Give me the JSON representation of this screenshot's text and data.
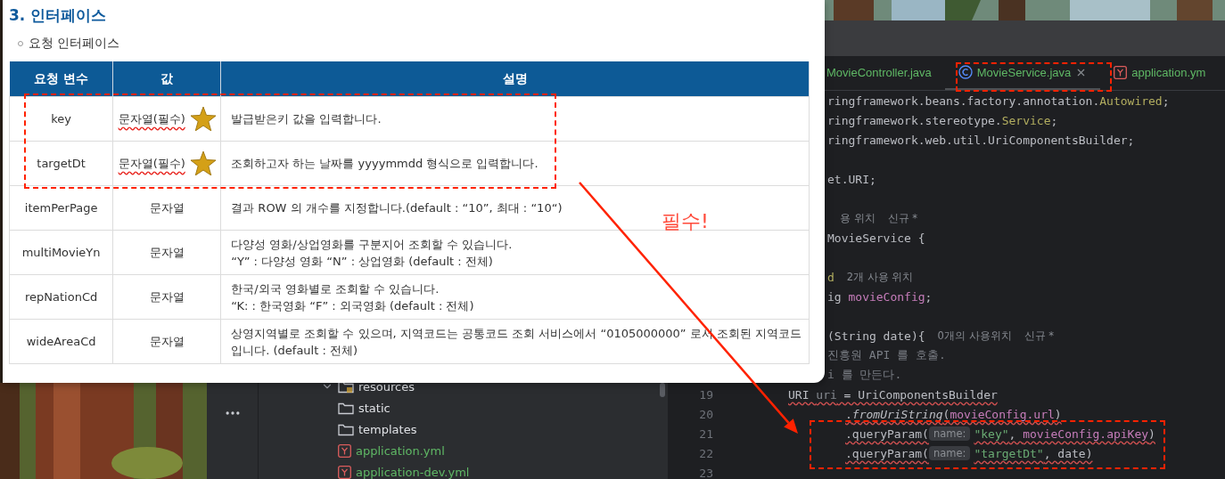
{
  "document": {
    "title": "3. 인터페이스",
    "subtitle": "요청 인터페이스",
    "table": {
      "columns": [
        "요청 변수",
        "값",
        "설명"
      ],
      "rows": [
        {
          "name": "key",
          "value": "문자열(필수)",
          "starred": true,
          "description": [
            "발급받은키 값을 입력합니다."
          ]
        },
        {
          "name": "targetDt",
          "value": "문자열(필수)",
          "starred": true,
          "description": [
            "조회하고자 하는 날짜를 yyyymmdd 형식으로 입력합니다."
          ]
        },
        {
          "name": "itemPerPage",
          "value": "문자열",
          "starred": false,
          "description": [
            "결과 ROW 의 개수를 지정합니다.(default : “10”, 최대 : “10“)"
          ]
        },
        {
          "name": "multiMovieYn",
          "value": "문자열",
          "starred": false,
          "description": [
            "다양성 영화/상업영화를 구분지어 조회할 수 있습니다.",
            "“Y” : 다양성 영화 “N” : 상업영화 (default : 전체)"
          ]
        },
        {
          "name": "repNationCd",
          "value": "문자열",
          "starred": false,
          "description": [
            "한국/외국 영화별로 조회할 수 있습니다.",
            "“K: : 한국영화 “F” : 외국영화 (default : 전체)"
          ]
        },
        {
          "name": "wideAreaCd",
          "value": "문자열",
          "starred": false,
          "description": [
            "상영지역별로 조회할 수 있으며, 지역코드는 공통코드 조회 서비스에서 “0105000000” 로서 조회된 지역코드",
            "입니다. (default : 전체)"
          ]
        }
      ]
    }
  },
  "ide": {
    "tabs": [
      {
        "label": "MovieController.java",
        "kind": "plain",
        "selected": false
      },
      {
        "label": "MovieService.java",
        "kind": "class",
        "selected": true
      },
      {
        "label": "application.ym",
        "kind": "yaml",
        "selected": false
      }
    ],
    "tree": [
      {
        "label": "resources",
        "kind": "resources",
        "expanded": true,
        "children": [
          {
            "label": "static",
            "kind": "folder"
          },
          {
            "label": "templates",
            "kind": "folder"
          },
          {
            "label": "application.yml",
            "kind": "yaml"
          },
          {
            "label": "application-dev.yml",
            "kind": "yaml"
          }
        ]
      }
    ],
    "code_lines": [
      {
        "kind": "cut",
        "tokens": [
          {
            "kind": "plain",
            "text": "ringframework.beans.factory.annotation."
          },
          {
            "kind": "type",
            "text": "Autowired"
          },
          {
            "kind": "plain",
            "text": ";"
          }
        ]
      },
      {
        "kind": "cut",
        "tokens": [
          {
            "kind": "plain",
            "text": "ringframework.stereotype."
          },
          {
            "kind": "type",
            "text": "Service"
          },
          {
            "kind": "plain",
            "text": ";"
          }
        ]
      },
      {
        "kind": "cut",
        "tokens": [
          {
            "kind": "plain",
            "text": "ringframework.web.util.UriComponentsBuilder;"
          }
        ]
      },
      {
        "kind": "empty"
      },
      {
        "kind": "cut",
        "tokens": [
          {
            "kind": "plain",
            "text": "et.URI;"
          }
        ]
      },
      {
        "kind": "empty"
      },
      {
        "kind": "cut",
        "tokens": [
          {
            "kind": "hint",
            "text": "용 위치"
          },
          {
            "kind": "hint",
            "text": "신규 *"
          }
        ]
      },
      {
        "kind": "cut",
        "tokens": [
          {
            "kind": "plain",
            "text": "MovieService {"
          }
        ]
      },
      {
        "kind": "empty"
      },
      {
        "kind": "cut",
        "tokens": [
          {
            "kind": "type",
            "text": "d"
          },
          {
            "kind": "hint",
            "text": "2개 사용 위치"
          }
        ]
      },
      {
        "kind": "cut",
        "tokens": [
          {
            "kind": "plain",
            "text": "ig "
          },
          {
            "kind": "field",
            "text": "movieConfig"
          },
          {
            "kind": "plain",
            "text": ";"
          }
        ]
      },
      {
        "kind": "empty"
      },
      {
        "kind": "cut",
        "tokens": [
          {
            "kind": "plain",
            "text": "(String date){"
          },
          {
            "kind": "hint",
            "text": "0개의 사용위치"
          },
          {
            "kind": "hint",
            "text": "신규 *"
          }
        ]
      },
      {
        "kind": "cut",
        "tokens": [
          {
            "kind": "comment",
            "text": "진흥원 API 를 호출."
          }
        ]
      },
      {
        "kind": "cut",
        "tokens": [
          {
            "kind": "comment",
            "text": "i 를 만든다."
          }
        ]
      },
      {
        "kind": "statement",
        "number": "19",
        "error": true,
        "tokens": [
          {
            "kind": "plain",
            "text": "URI "
          },
          {
            "kind": "unused",
            "text": "uri"
          },
          {
            "kind": "plain",
            "text": " = UriComponentsBuilder"
          }
        ]
      },
      {
        "kind": "chain",
        "number": "20",
        "error": true,
        "tokens": [
          {
            "kind": "plain",
            "text": "."
          },
          {
            "kind": "italic",
            "text": "fromUriString"
          },
          {
            "kind": "plain",
            "text": "("
          },
          {
            "kind": "field",
            "text": "movieConfig.url"
          },
          {
            "kind": "plain",
            "text": ")"
          }
        ]
      },
      {
        "kind": "chain",
        "number": "21",
        "error": true,
        "tokens": [
          {
            "kind": "plain",
            "text": ".queryParam("
          },
          {
            "kind": "param",
            "text": "name:"
          },
          {
            "kind": "string",
            "text": "\"key\""
          },
          {
            "kind": "plain",
            "text": ", "
          },
          {
            "kind": "field",
            "text": "movieConfig.apiKey"
          },
          {
            "kind": "plain",
            "text": ")"
          }
        ]
      },
      {
        "kind": "chain",
        "number": "22",
        "error": true,
        "tokens": [
          {
            "kind": "plain",
            "text": ".queryParam("
          },
          {
            "kind": "param",
            "text": "name:"
          },
          {
            "kind": "string",
            "text": "\"targetDt\""
          },
          {
            "kind": "plain",
            "text": ", date)"
          }
        ]
      },
      {
        "kind": "empty",
        "number": "23"
      }
    ]
  },
  "annotation": {
    "note": "필수!"
  }
}
